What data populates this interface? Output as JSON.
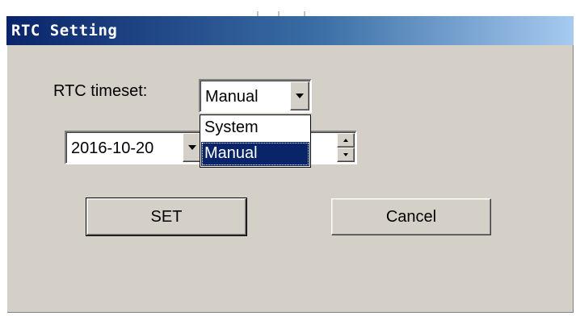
{
  "window": {
    "title": "RTC Setting"
  },
  "form": {
    "timeset_label": "RTC timeset:",
    "timeset_value": "Manual",
    "timeset_options": [
      {
        "label": "System",
        "selected": false
      },
      {
        "label": "Manual",
        "selected": true
      }
    ],
    "date_value": "2016-10-20"
  },
  "buttons": {
    "set_label": "SET",
    "cancel_label": "Cancel"
  },
  "colors": {
    "titlebar_start": "#0a246a",
    "titlebar_end": "#a6caf0",
    "dialog_bg": "#d4d0c8",
    "selection_bg": "#0a246a"
  },
  "icons": {
    "combo_arrow": "chevron-down-icon",
    "date_arrow": "chevron-down-icon",
    "spin_up": "spin-up-icon",
    "spin_down": "spin-down-icon"
  }
}
